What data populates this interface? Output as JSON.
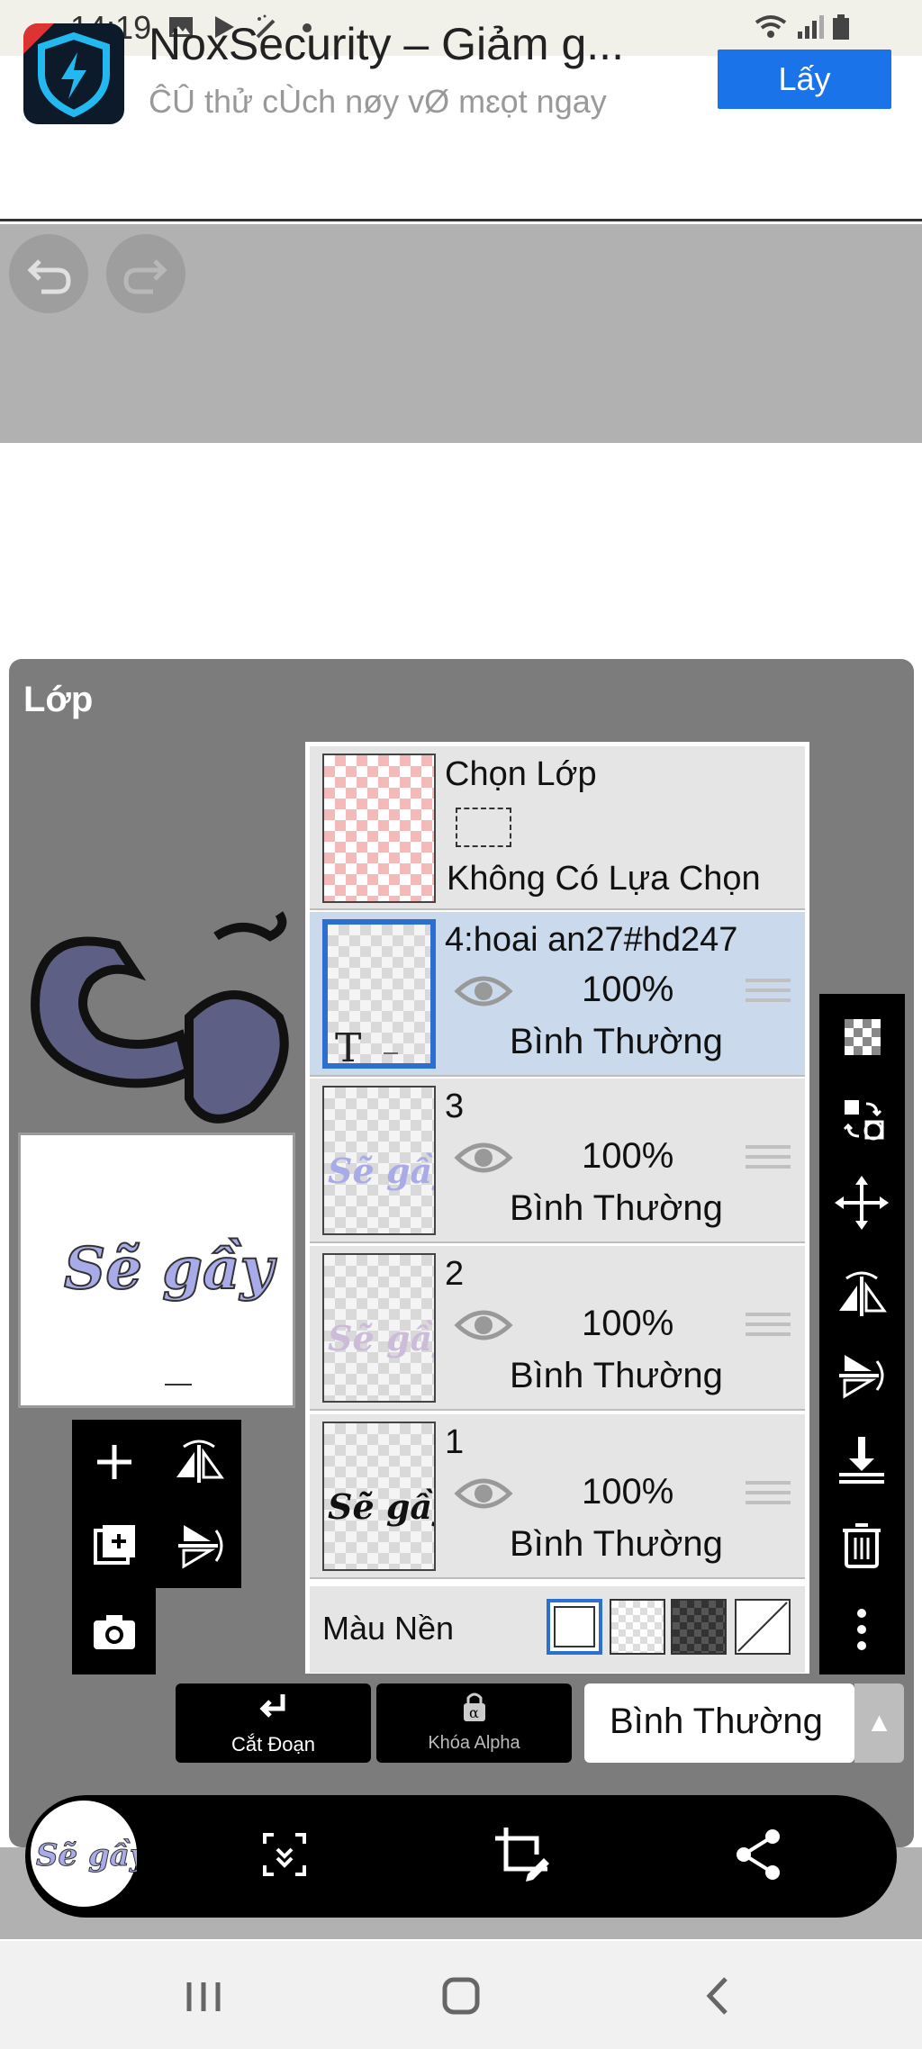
{
  "status_bar": {
    "time": "14:19",
    "icons": [
      "gallery-icon",
      "play-store-icon",
      "magic-wand-icon",
      "dot-icon",
      "wifi-icon",
      "signal-icon",
      "battery-icon"
    ]
  },
  "ad": {
    "title": "NoxSecurity – Giảm g...",
    "subtitle": "ĈÛ thử cÙch nøy vØ mɛọt ngay",
    "cta": "Lấy"
  },
  "canvas": {
    "undo_icon": "undo-icon",
    "redo_icon": "redo-icon"
  },
  "panel": {
    "title": "Lớp",
    "selection_layer": {
      "title": "Chọn Lớp",
      "status": "Không Có Lựa Chọn"
    },
    "layers": [
      {
        "name": "4:hoai an27#hd247",
        "opacity": "100%",
        "blend": "Bình Thường",
        "selected": true,
        "type": "text"
      },
      {
        "name": "3",
        "opacity": "100%",
        "blend": "Bình Thường",
        "selected": false,
        "type": "image"
      },
      {
        "name": "2",
        "opacity": "100%",
        "blend": "Bình Thường",
        "selected": false,
        "type": "image"
      },
      {
        "name": "1",
        "opacity": "100%",
        "blend": "Bình Thường",
        "selected": false,
        "type": "image"
      }
    ],
    "background": {
      "label": "Màu Nền",
      "options": [
        "white",
        "transparent",
        "dark-checker",
        "none"
      ],
      "selected": "white"
    },
    "text_thumb_glyph": "T",
    "artwork_text": "Sẽ gầy"
  },
  "bottom_toolbar": {
    "clip_label": "Cắt Đoạn",
    "alpha_lock_label": "Khóa Alpha",
    "blend_mode": "Bình Thường"
  },
  "colors": {
    "accent_blue": "#2c6fd0",
    "ad_button": "#1a73e8",
    "panel_gray": "#7c7c7c",
    "selected_row": "#cbd9ed",
    "art_purple": "#a9abe8"
  }
}
